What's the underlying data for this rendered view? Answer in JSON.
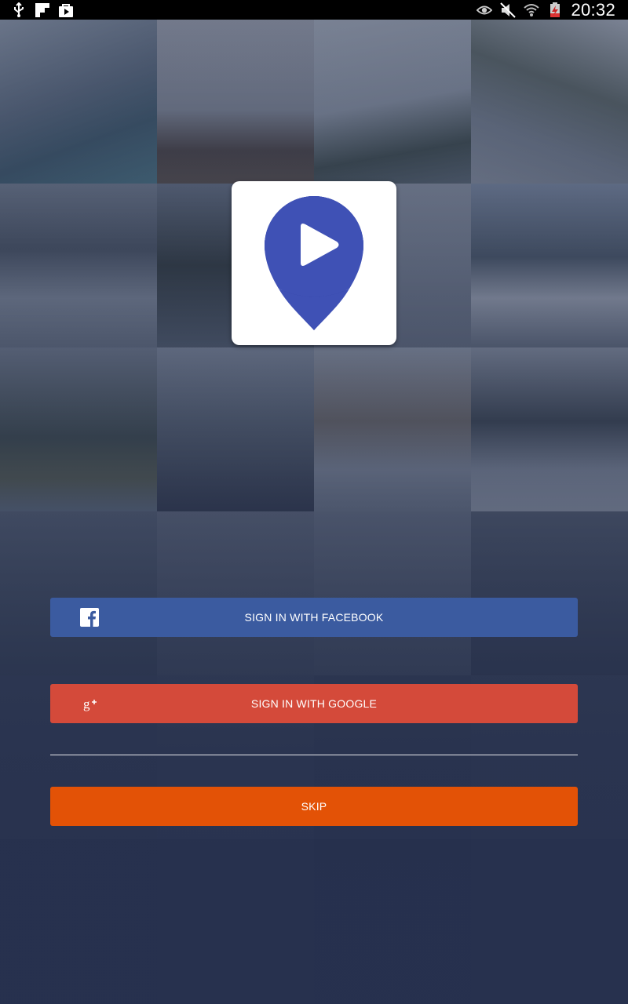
{
  "status_bar": {
    "time": "20:32",
    "left_icons": [
      "usb-icon",
      "flipboard-icon",
      "store-bag-icon"
    ],
    "right_icons": [
      "eye-icon",
      "muted-icon",
      "wifi-icon",
      "battery-charging-icon"
    ]
  },
  "logo": {
    "icon": "location-pin-play-icon",
    "pin_color": "#3f51b5",
    "pin_shadow_color": "#303f9f"
  },
  "buttons": {
    "facebook": {
      "label": "SIGN IN WITH FACEBOOK",
      "icon": "facebook-icon",
      "color": "#3b5ba0"
    },
    "google": {
      "label": "SIGN IN WITH GOOGLE",
      "icon": "google-plus-icon",
      "color": "#d44a3a"
    },
    "skip": {
      "label": "SKIP",
      "color": "#e35206"
    }
  }
}
